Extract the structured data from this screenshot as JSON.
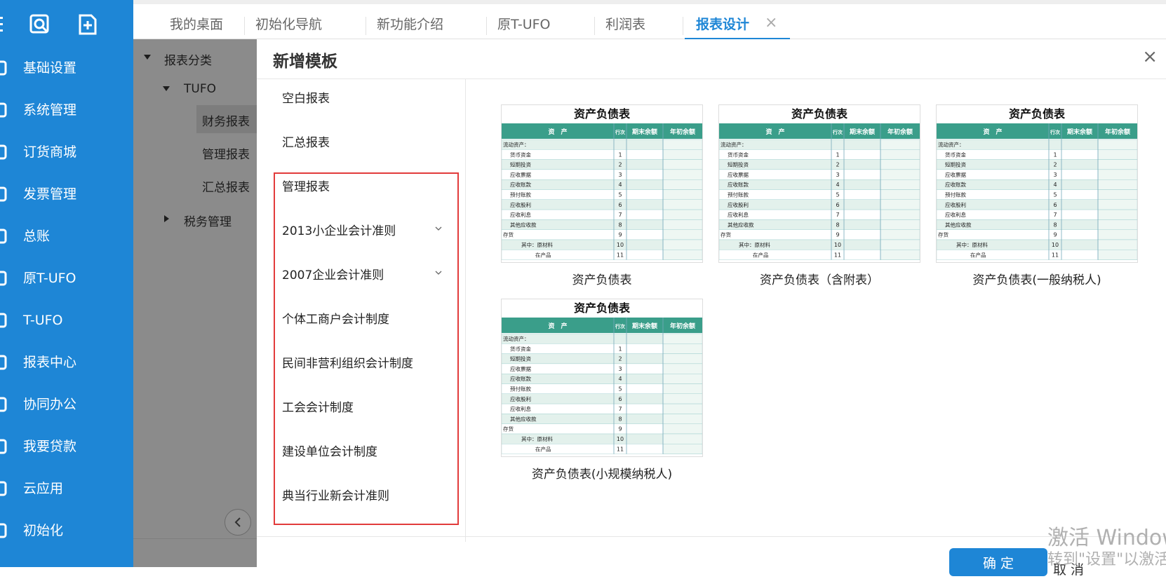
{
  "nav": {
    "items": [
      {
        "label": "基础设置"
      },
      {
        "label": "系统管理"
      },
      {
        "label": "订货商城"
      },
      {
        "label": "发票管理"
      },
      {
        "label": "总账"
      },
      {
        "label": "原T-UFO"
      },
      {
        "label": "T-UFO"
      },
      {
        "label": "报表中心"
      },
      {
        "label": "协同办公"
      },
      {
        "label": "我要贷款"
      },
      {
        "label": "云应用"
      },
      {
        "label": "初始化"
      }
    ]
  },
  "tabs": [
    {
      "label": "我的桌面"
    },
    {
      "label": "初始化导航"
    },
    {
      "label": "新功能介绍"
    },
    {
      "label": "原T-UFO"
    },
    {
      "label": "利润表"
    },
    {
      "label": "报表设计",
      "active": true
    }
  ],
  "tab_close": "×",
  "background_tree": {
    "root": "报表分类",
    "tufo": "TUFO",
    "financial": "财务报表",
    "management": "管理报表",
    "summary": "汇总报表",
    "tax": "税务管理"
  },
  "modal": {
    "title": "新增模板",
    "close": "×",
    "categories": [
      {
        "label": "空白报表"
      },
      {
        "label": "汇总报表"
      },
      {
        "label": "管理报表"
      },
      {
        "label": "2013小企业会计准则",
        "expandable": true
      },
      {
        "label": "2007企业会计准则",
        "expandable": true
      },
      {
        "label": "个体工商户会计制度"
      },
      {
        "label": "民间非营利组织会计制度"
      },
      {
        "label": "工会会计制度"
      },
      {
        "label": "建设单位会计制度"
      },
      {
        "label": "典当行业新会计准则"
      }
    ],
    "templates": [
      {
        "caption": "资产负债表"
      },
      {
        "caption": "资产负债表（含附表）"
      },
      {
        "caption": "资产负债表(一般纳税人)"
      },
      {
        "caption": "资产负债表(小规模纳税人)"
      }
    ],
    "thumbnail": {
      "title": "资产负债表",
      "headers": [
        "资　产",
        "行次",
        "期末余额",
        "年初余额"
      ],
      "rows": [
        {
          "name": "流动资产：",
          "no": ""
        },
        {
          "name": "货币资金",
          "no": "1"
        },
        {
          "name": "短期投资",
          "no": "2"
        },
        {
          "name": "应收票据",
          "no": "3"
        },
        {
          "name": "应收账款",
          "no": "4"
        },
        {
          "name": "预付账款",
          "no": "5"
        },
        {
          "name": "应收股利",
          "no": "6"
        },
        {
          "name": "应收利息",
          "no": "7"
        },
        {
          "name": "其他应收款",
          "no": "8"
        },
        {
          "name": "存货",
          "no": "9"
        },
        {
          "name": "其中：原材料",
          "no": "10"
        },
        {
          "name": "在产品",
          "no": "11"
        }
      ]
    },
    "ok_label": "确 定",
    "cancel_label": "取 消"
  },
  "watermark": {
    "line1": "激活 Windows",
    "line2": "转到\"设置\"以激活"
  },
  "colors": {
    "nav_blue": "#1e86d6",
    "highlight_red": "#e23b3b",
    "table_header_teal": "#3a9e8a",
    "table_row_light": "#e3f1ec"
  }
}
